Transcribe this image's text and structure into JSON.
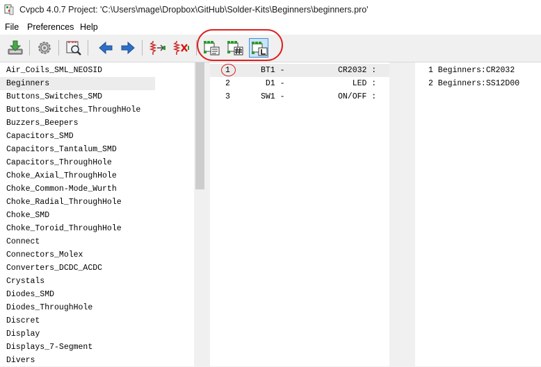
{
  "window": {
    "title": "Cvpcb 4.0.7  Project: 'C:\\Users\\mage\\Dropbox\\GitHub\\Solder-Kits\\Beginners\\beginners.pro'"
  },
  "menu": {
    "file": "File",
    "preferences": "Preferences",
    "help": "Help"
  },
  "toolbar": {
    "buttons": [
      {
        "icon": "save-icon"
      },
      {
        "icon": "settings-icon"
      },
      {
        "icon": "footprint-viewer-icon"
      },
      {
        "icon": "arrow-left-icon"
      },
      {
        "icon": "arrow-right-icon"
      },
      {
        "icon": "auto-associate-icon"
      },
      {
        "icon": "delete-associations-icon"
      },
      {
        "icon": "filter-by-keyword-icon"
      },
      {
        "icon": "filter-by-pin-count-icon"
      },
      {
        "icon": "filter-by-library-icon"
      }
    ],
    "accent": "#3d8ee2",
    "annotation_color": "#e01f1f"
  },
  "libraries": {
    "items": [
      "Air_Coils_SML_NEOSID",
      "Beginners",
      "Buttons_Switches_SMD",
      "Buttons_Switches_ThroughHole",
      "Buzzers_Beepers",
      "Capacitors_SMD",
      "Capacitors_Tantalum_SMD",
      "Capacitors_ThroughHole",
      "Choke_Axial_ThroughHole",
      "Choke_Common-Mode_Wurth",
      "Choke_Radial_ThroughHole",
      "Choke_SMD",
      "Choke_Toroid_ThroughHole",
      "Connect",
      "Connectors_Molex",
      "Converters_DCDC_ACDC",
      "Crystals",
      "Diodes_SMD",
      "Diodes_ThroughHole",
      "Discret",
      "Display",
      "Displays_7-Segment",
      "Divers"
    ],
    "selected": "Beginners"
  },
  "components": {
    "rows": [
      {
        "index": "1",
        "ref": "BT1 -",
        "value": "CR2032 :"
      },
      {
        "index": "2",
        "ref": " D1 -",
        "value": "   LED :"
      },
      {
        "index": "3",
        "ref": "SW1 -",
        "value": "ON/OFF :"
      }
    ]
  },
  "footprints": {
    "rows": [
      "1 Beginners:CR2032",
      "2 Beginners:SS12D00"
    ]
  }
}
